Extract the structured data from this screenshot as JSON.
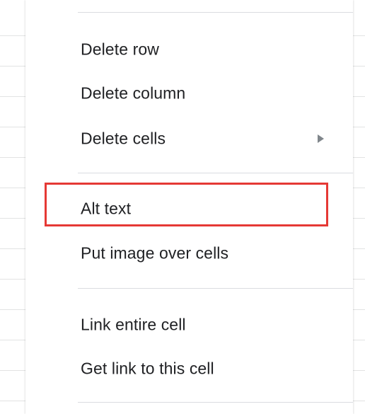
{
  "context_menu": {
    "items": [
      {
        "label": "Delete row",
        "has_submenu": false
      },
      {
        "label": "Delete column",
        "has_submenu": false
      },
      {
        "label": "Delete cells",
        "has_submenu": true,
        "submenu_icon": "triangle-right-icon"
      },
      {
        "label": "Alt text",
        "has_submenu": false,
        "highlighted": true
      },
      {
        "label": "Put image over cells",
        "has_submenu": false
      },
      {
        "label": "Link entire cell",
        "has_submenu": false
      },
      {
        "label": "Get link to this cell",
        "has_submenu": false
      }
    ],
    "highlight_color": "#e53935",
    "text_color": "#202124",
    "separator_color": "#dadce0"
  }
}
